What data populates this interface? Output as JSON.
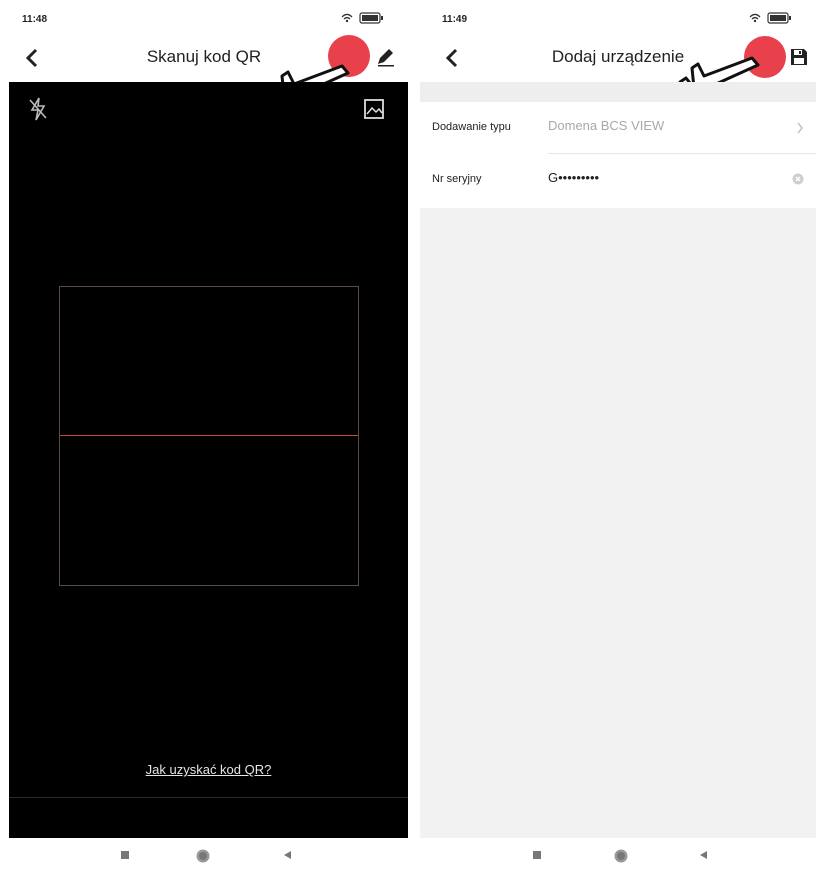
{
  "left": {
    "status": {
      "time": "11:48"
    },
    "appbar": {
      "title": "Skanuj kod QR"
    },
    "link": "Jak uzyskać kod QR?",
    "icons": [
      "back-icon",
      "flash-off-icon",
      "gallery-icon",
      "edit-icon",
      "pointing-hand-icon"
    ]
  },
  "right": {
    "status": {
      "time": "11:49"
    },
    "appbar": {
      "title": "Dodaj urządzenie"
    },
    "form": {
      "type": {
        "label": "Dodawanie typu",
        "value": "Domena BCS VIEW"
      },
      "serial": {
        "label": "Nr seryjny",
        "value": "G•••••••••"
      }
    },
    "icons": [
      "back-icon",
      "save-icon",
      "chevron-right-icon",
      "clear-icon",
      "pointing-hand-icon"
    ]
  },
  "colors": {
    "highlight": "#e8414b",
    "camera": "#000000",
    "scan_line": "#c0473e"
  }
}
